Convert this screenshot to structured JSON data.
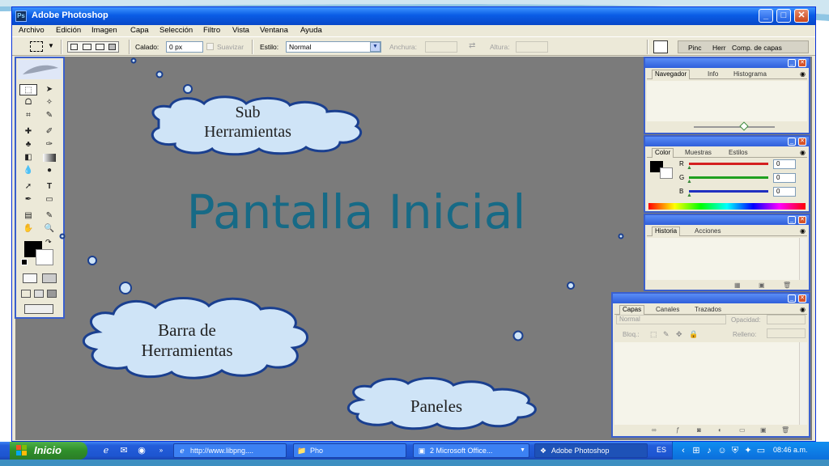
{
  "window": {
    "title": "Adobe Photoshop",
    "controls": {
      "minimize": "_",
      "maximize": "□",
      "close": "✕"
    }
  },
  "menubar": [
    "Archivo",
    "Edición",
    "Imagen",
    "Capa",
    "Selección",
    "Filtro",
    "Vista",
    "Ventana",
    "Ayuda"
  ],
  "options_bar": {
    "feather_label": "Calado:",
    "feather_value": "0 px",
    "antialias_label": "Suavizar",
    "style_label": "Estilo:",
    "style_value": "Normal",
    "width_label": "Anchura:",
    "height_label": "Altura:",
    "palette_well": {
      "brushes": "Pinc",
      "tools": "Herr",
      "layer_comps": "Comp. de capas"
    }
  },
  "overlay": {
    "title": "Pantalla Inicial",
    "cloud_sub": {
      "line1": "Sub",
      "line2": "Herramientas"
    },
    "cloud_toolbar": {
      "line1": "Barra de",
      "line2": "Herramientas"
    },
    "cloud_panels": "Paneles",
    "cloud_fill": "#cfe4f7",
    "cloud_stroke": "#1a3f8f"
  },
  "panels": {
    "navigator": {
      "tabs": [
        "Navegador",
        "Info",
        "Histograma"
      ]
    },
    "color": {
      "tabs": [
        "Color",
        "Muestras",
        "Estilos"
      ],
      "channels": [
        {
          "label": "R",
          "value": "0",
          "color": "#d42020"
        },
        {
          "label": "G",
          "value": "0",
          "color": "#20a020"
        },
        {
          "label": "B",
          "value": "0",
          "color": "#2030c0"
        }
      ]
    },
    "history": {
      "tabs": [
        "Historia",
        "Acciones"
      ]
    },
    "layers": {
      "tabs": [
        "Capas",
        "Canales",
        "Trazados"
      ],
      "blend_mode": "Normal",
      "opacity_label": "Opacidad:",
      "lock_label": "Bloq.:",
      "fill_label": "Relleno:"
    }
  },
  "taskbar": {
    "start_label": "Inicio",
    "items": [
      {
        "label": "http://www.libpng....",
        "icon": "ie-icon"
      },
      {
        "label": "Pho",
        "icon": "folder-icon"
      },
      {
        "label": "2 Microsoft Office...",
        "icon": "office-icon"
      },
      {
        "label": "Adobe Photoshop",
        "icon": "photoshop-icon"
      }
    ],
    "language": "ES",
    "clock": "08:46 a.m."
  }
}
